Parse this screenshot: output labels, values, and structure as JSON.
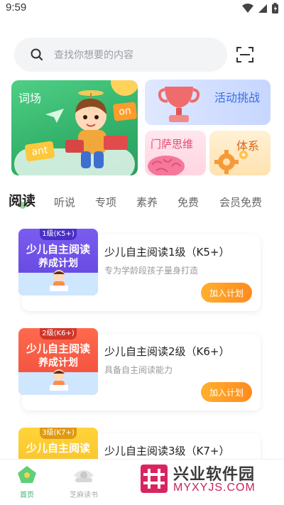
{
  "status_bar": {
    "time": "9:59"
  },
  "search": {
    "placeholder": "查找你想要的内容"
  },
  "banners": {
    "words": {
      "title": "词场",
      "tag1": "on",
      "tag2": "ant"
    },
    "challenge": {
      "title": "活动挑战"
    },
    "mensa": {
      "title": "门萨思维"
    },
    "system": {
      "title": "体系"
    }
  },
  "tabs": [
    "阅读",
    "听说",
    "专项",
    "素养",
    "免费",
    "会员免费"
  ],
  "cards": [
    {
      "level": "1级(K5+)",
      "cover_line1": "少儿自主阅读",
      "cover_line2": "养成计划",
      "title": "少儿自主阅读1级（K5+）",
      "subtitle": "专为学龄段孩子量身打造",
      "button": "加入计划"
    },
    {
      "level": "2级(K6+)",
      "cover_line1": "少儿自主阅读",
      "cover_line2": "养成计划",
      "title": "少儿自主阅读2级（K6+）",
      "subtitle": "具备自主阅读能力",
      "button": "加入计划"
    },
    {
      "level": "3级(K7+)",
      "cover_line1": "少儿自主阅读",
      "cover_line2": "",
      "title": "少儿自主阅读3级（K7+）",
      "subtitle": "",
      "button": ""
    }
  ],
  "bottom_nav": {
    "home": "首页",
    "reading": "芝麻读书"
  },
  "watermark": {
    "cn": "兴业软件园",
    "en": "MYXYJS.COM"
  },
  "colors": {
    "accent_orange": "#ff9a24",
    "nav_active": "#3cb371",
    "cover_purple": "#6b4de6",
    "cover_red": "#f0533f",
    "cover_yellow": "#f5b820"
  }
}
